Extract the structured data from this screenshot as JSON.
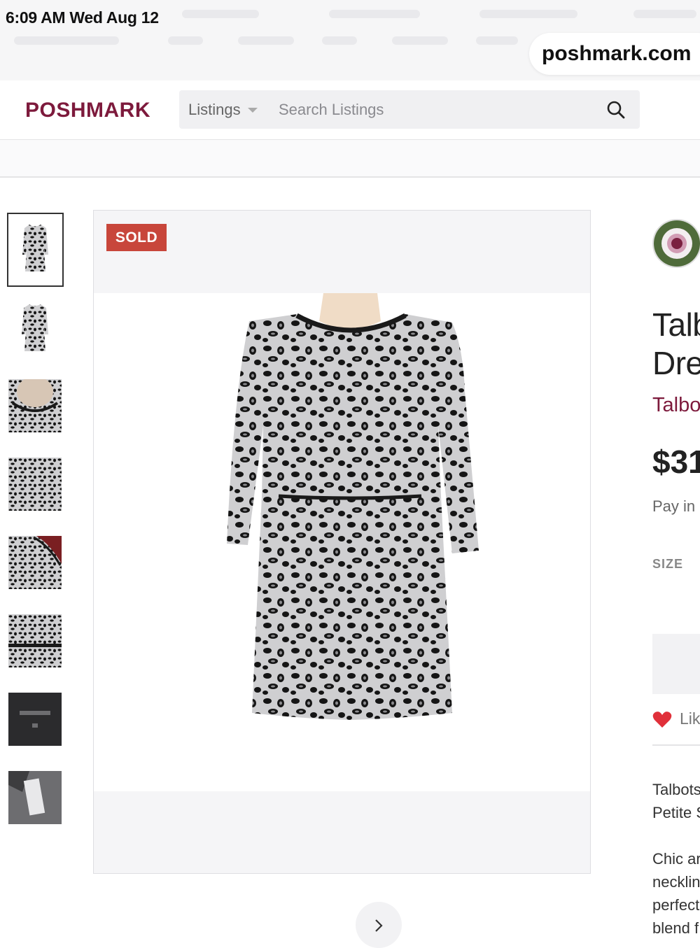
{
  "status_bar": {
    "time_date": "6:09 AM   Wed Aug 12"
  },
  "browser": {
    "url": "poshmark.com"
  },
  "header": {
    "logo": "POSHMARK",
    "search": {
      "category": "Listings",
      "placeholder": "Search Listings"
    }
  },
  "listing": {
    "badge": "SOLD",
    "thumbnails": [
      {
        "kind": "dress"
      },
      {
        "kind": "dress"
      },
      {
        "kind": "collar"
      },
      {
        "kind": "pattern"
      },
      {
        "kind": "shoulder"
      },
      {
        "kind": "belt"
      },
      {
        "kind": "label"
      },
      {
        "kind": "tag"
      }
    ],
    "title_lines": [
      "Talb",
      "Dre"
    ],
    "brand": "Talbo",
    "price": "$31",
    "pay_in": "Pay in",
    "size_label": "SIZE",
    "like": "Lik",
    "description_lines_1": [
      "Talbots",
      "Petite S"
    ],
    "description_lines_2": [
      "Chic ar",
      "necklin",
      "perfect",
      "blend f"
    ]
  },
  "colors": {
    "brand": "#7d1a3c",
    "sold_badge": "#c8463b",
    "heart": "#e0303a"
  }
}
